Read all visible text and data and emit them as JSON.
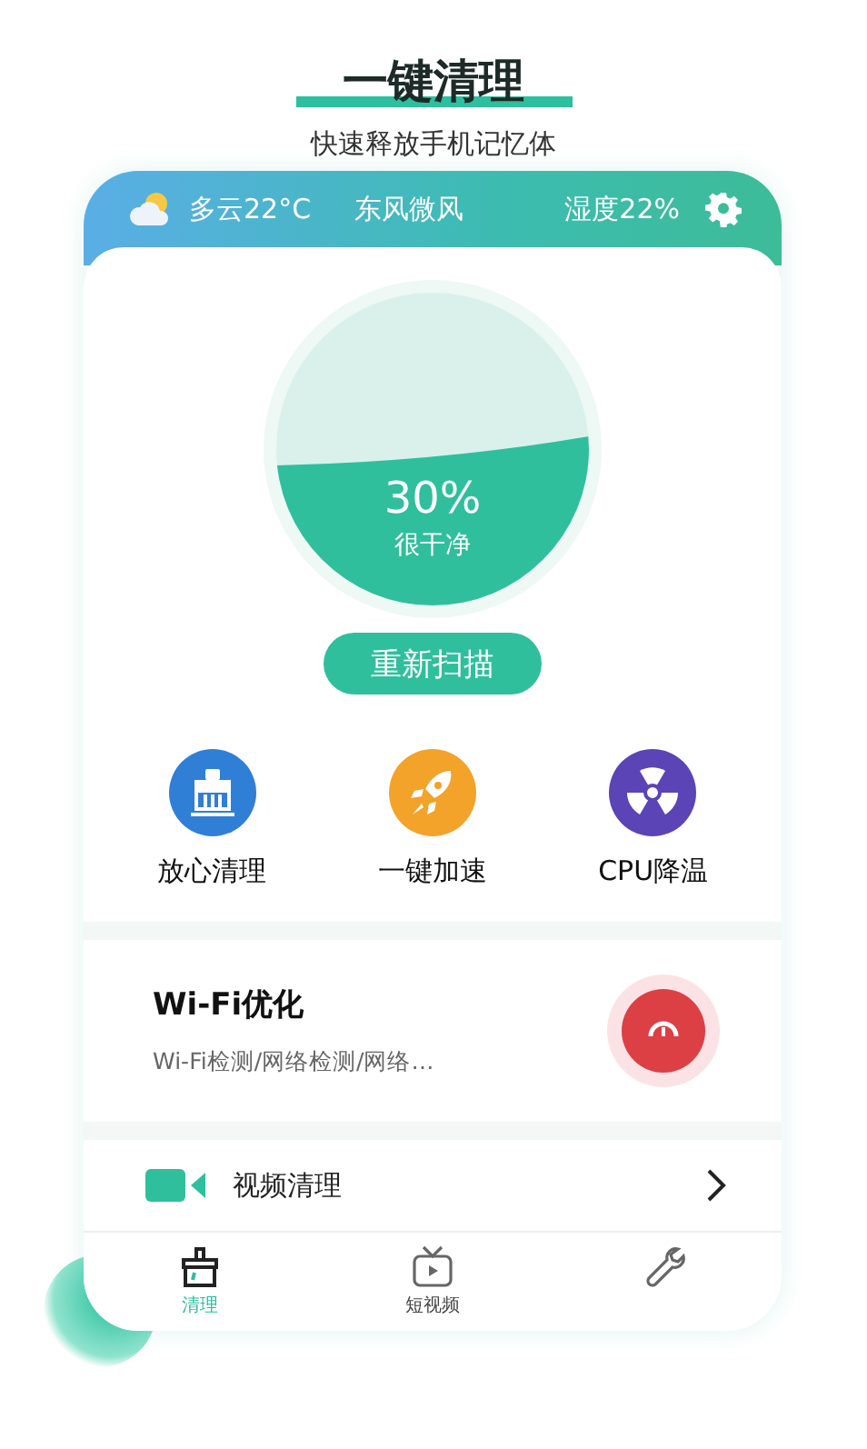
{
  "header": {
    "title": "一键清理",
    "subtitle": "快速释放手机记忆体"
  },
  "weather": {
    "condition": "多云22°C",
    "wind": "东风微风",
    "humidity": "湿度22%"
  },
  "gauge": {
    "percent": "30%",
    "status": "很干净"
  },
  "rescan_button": "重新扫描",
  "features": [
    {
      "kind": "clean",
      "label": "放心清理",
      "color": "#2f7fd6"
    },
    {
      "kind": "boost",
      "label": "一键加速",
      "color": "#f3a22a"
    },
    {
      "kind": "cool",
      "label": "CPU降温",
      "color": "#5b44b5"
    }
  ],
  "wifi": {
    "title": "Wi-Fi优化",
    "description": "Wi-Fi检测/网络检测/网络…"
  },
  "list": [
    {
      "kind": "video",
      "label": "视频清理"
    }
  ],
  "tabs": [
    {
      "kind": "clean",
      "label": "清理",
      "selected": true
    },
    {
      "kind": "tv",
      "label": "短视频",
      "selected": false
    },
    {
      "kind": "tool",
      "selected": false
    }
  ]
}
